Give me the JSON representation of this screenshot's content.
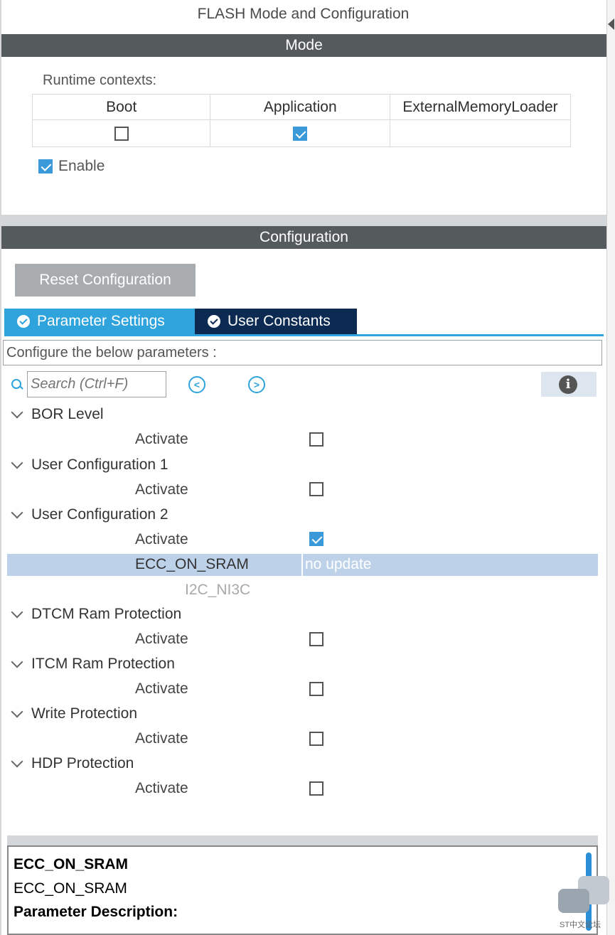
{
  "panel": {
    "title": "FLASH Mode and Configuration",
    "mode_header": "Mode",
    "config_header": "Configuration"
  },
  "mode": {
    "runtime_label": "Runtime contexts:",
    "columns": [
      "Boot",
      "Application",
      "ExternalMemoryLoader"
    ],
    "checked": [
      false,
      true,
      null
    ],
    "enable_label": "Enable",
    "enable_checked": true
  },
  "config": {
    "reset_label": "Reset Configuration",
    "tabs": [
      {
        "label": "Parameter Settings",
        "active": true
      },
      {
        "label": "User Constants",
        "active": false
      }
    ],
    "description": "Configure the below parameters :",
    "search_placeholder": "Search (Ctrl+F)",
    "prev_symbol": "<",
    "next_symbol": ">",
    "info_symbol": "i"
  },
  "groups": [
    {
      "name": "BOR Level",
      "param": "Activate",
      "checked": false
    },
    {
      "name": "User Configuration 1",
      "param": "Activate",
      "checked": false
    },
    {
      "name": "User Configuration 2",
      "param": "Activate",
      "checked": true
    },
    {
      "name": "DTCM Ram Protection",
      "param": "Activate",
      "checked": false
    },
    {
      "name": "ITCM Ram Protection",
      "param": "Activate",
      "checked": false
    },
    {
      "name": "Write Protection",
      "param": "Activate",
      "checked": false
    },
    {
      "name": "HDP Protection",
      "param": "Activate",
      "checked": false
    }
  ],
  "selected_param": {
    "label": "ECC_ON_SRAM",
    "value": "no update"
  },
  "disabled_param": "I2C_NI3C",
  "description_panel": {
    "title": "ECC_ON_SRAM",
    "subtitle": "ECC_ON_SRAM",
    "heading": "Parameter Description:"
  },
  "watermark": "ST中文论坛",
  "colors": {
    "accent": "#2fa3db",
    "tab_inactive": "#0d2b52",
    "band": "#555a5d",
    "selected_row": "#bdd2e8"
  },
  "icons": {
    "search": "search-icon",
    "prev": "circle-chevron-left-icon",
    "next": "circle-chevron-right-icon",
    "info": "info-icon"
  }
}
